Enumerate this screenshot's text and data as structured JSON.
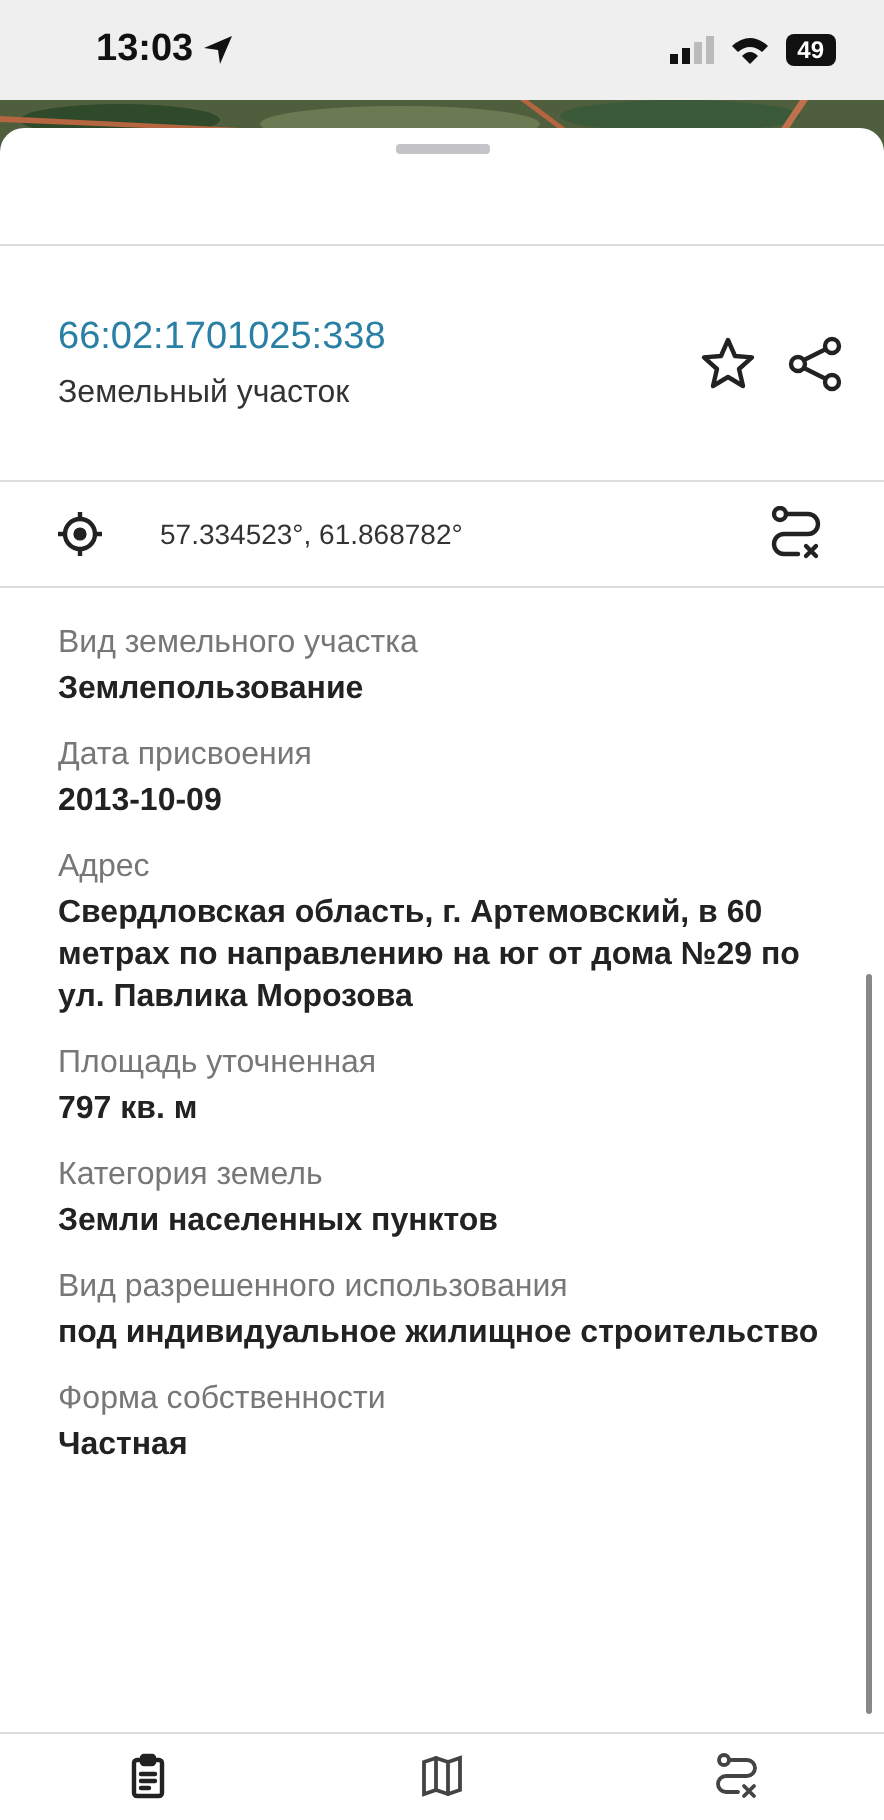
{
  "status_bar": {
    "time": "13:03",
    "battery": "49"
  },
  "header": {
    "number": "66:02:1701025:338",
    "type": "Земельный участок",
    "favorite": false
  },
  "coordinates": {
    "text": "57.334523°, 61.868782°"
  },
  "fields": [
    {
      "label": "Вид земельного участка",
      "value": "Землепользование"
    },
    {
      "label": "Дата присвоения",
      "value": "2013-10-09"
    },
    {
      "label": "Адрес",
      "value": "Свердловская область, г. Артемовский,  в 60 метрах по направлению на юг от дома №29 по ул. Павлика Морозова"
    },
    {
      "label": "Площадь уточненная",
      "value": "797 кв. м"
    },
    {
      "label": "Категория земель",
      "value": "Земли населенных пунктов"
    },
    {
      "label": "Вид разрешенного использования",
      "value": "под индивидуальное жилищное строительство"
    },
    {
      "label": "Форма собственности",
      "value": "Частная"
    }
  ],
  "bottom_tabs": [
    {
      "kind": "info",
      "selected": true
    },
    {
      "kind": "map",
      "selected": false
    },
    {
      "kind": "route",
      "selected": false
    }
  ]
}
